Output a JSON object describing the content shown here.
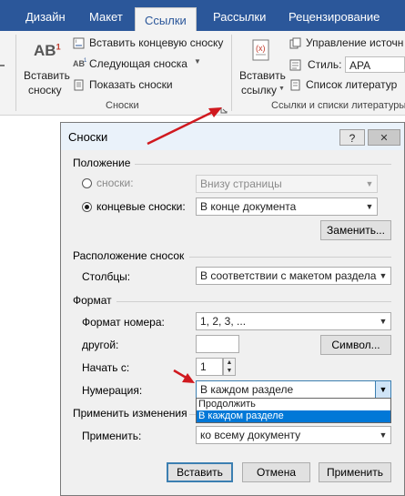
{
  "ribbon": {
    "tabs": [
      "Дизайн",
      "Макет",
      "Ссылки",
      "Рассылки",
      "Рецензирование"
    ],
    "active_tab": "Ссылки",
    "footnotes_group": {
      "insert_footnote": [
        "Вставить",
        "сноску"
      ],
      "insert_endnote": "Вставить концевую сноску",
      "next_footnote": "Следующая сноска",
      "show_notes": "Показать сноски",
      "group_label": "Сноски"
    },
    "citations_group": {
      "insert_citation": [
        "Вставить",
        "ссылку"
      ],
      "manage_sources": "Управление источн",
      "style_label": "Стиль:",
      "style_value": "APA",
      "bibliography": "Список литератур",
      "group_label": "Ссылки и списки литературы"
    }
  },
  "dialog": {
    "title": "Сноски",
    "help_button": "?",
    "close_button": "✕",
    "position": {
      "header": "Положение",
      "footnotes_label": "сноски:",
      "footnotes_value": "Внизу страницы",
      "endnotes_label": "концевые сноски:",
      "endnotes_value": "В конце документа",
      "convert_button": "Заменить..."
    },
    "layout": {
      "header": "Расположение сносок",
      "columns_label": "Столбцы:",
      "columns_value": "В соответствии с макетом раздела"
    },
    "format": {
      "header": "Формат",
      "number_format_label": "Формат номера:",
      "number_format_value": "1, 2, 3, ...",
      "custom_label": "другой:",
      "custom_value": "",
      "symbol_button": "Символ...",
      "start_at_label": "Начать с:",
      "start_at_value": "1",
      "numbering_label": "Нумерация:",
      "numbering_value": "В каждом разделе",
      "numbering_options": [
        "Продолжить",
        "В каждом разделе"
      ],
      "numbering_selected": "В каждом разделе"
    },
    "apply_changes": {
      "header": "Применить изменения",
      "apply_to_label": "Применить:",
      "apply_to_value": "ко всему документу"
    },
    "buttons": {
      "insert": "Вставить",
      "cancel": "Отмена",
      "apply": "Применить"
    }
  },
  "colors": {
    "ribbon_blue": "#2b579a",
    "annotation_arrow": "#d0191f",
    "selection_blue": "#0078d7"
  }
}
